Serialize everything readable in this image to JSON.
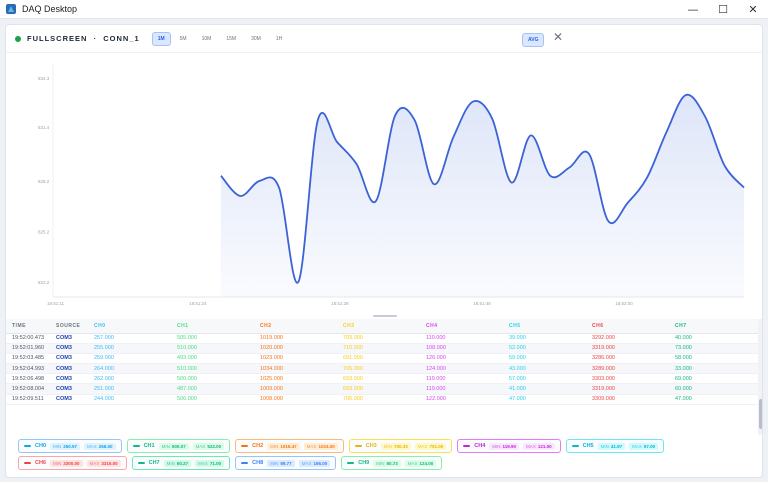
{
  "window": {
    "title": "DAQ Desktop",
    "controls": [
      "—",
      "☐",
      "✕"
    ]
  },
  "toolbar": {
    "mode_label": "FULLSCREEN",
    "separator": "·",
    "connection": "CONN_1",
    "ranges": [
      "1M",
      "5M",
      "10M",
      "15M",
      "30M",
      "1H"
    ],
    "active_range": "1M",
    "avg_label": "AVG",
    "close_glyph": "✕",
    "status_color": "#16a34a"
  },
  "chart_data": {
    "type": "area",
    "title": "",
    "xlabel": "",
    "ylabel": "",
    "line_color": "#3b63d6",
    "fill_color": "#dce4f8",
    "y_ticks": [
      822.2,
      825.2,
      828.2,
      831.4,
      834.3
    ],
    "y_tick_labels": [
      "822.2",
      "825.2",
      "828.2",
      "831.4",
      "834.3"
    ],
    "ylim": [
      821.3,
      835.2
    ],
    "x_ticks": [
      0,
      11,
      22,
      33,
      44
    ],
    "x_tick_labels": [
      "18:51:11",
      "18:51:24",
      "18:51:38",
      "18:51:48",
      "18:52:00"
    ],
    "xlim": [
      0,
      53.5
    ],
    "x": [
      13,
      14.5,
      16,
      17.5,
      19,
      20.5,
      22,
      23.5,
      25,
      26.5,
      28,
      29.5,
      31,
      32.5,
      34,
      35.5,
      37,
      38.5,
      40,
      41.5,
      43,
      44.5,
      46,
      47.5,
      49,
      50.5,
      52,
      53.5
    ],
    "y": [
      828.5,
      827.3,
      828.2,
      827.8,
      822.2,
      831.8,
      830.5,
      829.2,
      827.0,
      832.1,
      831.8,
      828.0,
      830.8,
      832.9,
      831.9,
      828.1,
      830.9,
      828.5,
      829.0,
      829.8,
      825.8,
      826.9,
      828.4,
      831.1,
      833.3,
      832.0,
      829.1,
      827.8
    ]
  },
  "table": {
    "columns": [
      {
        "label": "TIME",
        "color": "#6b7280"
      },
      {
        "label": "SOURCE",
        "color": "#6b7280"
      },
      {
        "label": "CH0",
        "color": "#38bdf8"
      },
      {
        "label": "CH1",
        "color": "#4ade80"
      },
      {
        "label": "CH2",
        "color": "#f97316"
      },
      {
        "label": "CH3",
        "color": "#facc15"
      },
      {
        "label": "CH4",
        "color": "#d946ef"
      },
      {
        "label": "CH5",
        "color": "#22d3ee"
      },
      {
        "label": "CH6",
        "color": "#ef4444"
      },
      {
        "label": "CH7",
        "color": "#10b981"
      }
    ],
    "rows": [
      [
        "19:52:00.473",
        "COM3",
        "257.000",
        "505.000",
        "1019.000",
        "703.000",
        "110.000",
        "39.000",
        "3292.000",
        "40.000"
      ],
      [
        "19:52:01.960",
        "COM3",
        "255.000",
        "510.000",
        "1020.000",
        "710.000",
        "108.000",
        "52.000",
        "3319.000",
        "73.000"
      ],
      [
        "19:52:03.485",
        "COM3",
        "259.000",
        "493.000",
        "1023.000",
        "691.000",
        "126.000",
        "59.000",
        "3286.000",
        "58.000"
      ],
      [
        "19:52:04.993",
        "COM3",
        "264.000",
        "510.000",
        "1034.000",
        "705.000",
        "124.000",
        "43.000",
        "3289.000",
        "33.000"
      ],
      [
        "19:52:06.498",
        "COM3",
        "262.000",
        "500.000",
        "1025.000",
        "693.000",
        "119.000",
        "57.000",
        "3303.000",
        "69.000"
      ],
      [
        "19:52:08.004",
        "COM3",
        "251.000",
        "487.000",
        "1009.000",
        "693.000",
        "119.000",
        "41.000",
        "3319.000",
        "60.000"
      ],
      [
        "19:52:09.511",
        "COM3",
        "244.000",
        "506.000",
        "1008.000",
        "706.000",
        "122.000",
        "47.000",
        "3309.000",
        "47.000"
      ]
    ],
    "time_color": "#4b5563",
    "source_color": "#1e40af"
  },
  "channels": [
    {
      "name": "CH0",
      "color": "#0ea5e9",
      "bg": "#e0f2fe",
      "border": "#93c5fd",
      "min_key": "MIN",
      "min": "250.97",
      "max_key": "MAX",
      "max": "266.00"
    },
    {
      "name": "CH1",
      "color": "#10b981",
      "bg": "#dcfce7",
      "border": "#86efac",
      "min_key": "MIN",
      "min": "500.07",
      "max_key": "MAX",
      "max": "522.00"
    },
    {
      "name": "CH2",
      "color": "#f97316",
      "bg": "#ffedd5",
      "border": "#fdba74",
      "min_key": "MIN",
      "min": "1016.47",
      "max_key": "MAX",
      "max": "1024.00"
    },
    {
      "name": "CH3",
      "color": "#eab308",
      "bg": "#fef9c3",
      "border": "#fde047",
      "min_key": "MIN",
      "min": "700.33",
      "max_key": "MAX",
      "max": "701.00"
    },
    {
      "name": "CH4",
      "color": "#c026d3",
      "bg": "#fae8ff",
      "border": "#e879f9",
      "min_key": "MIN",
      "min": "119.90",
      "max_key": "MAX",
      "max": "121.00"
    },
    {
      "name": "CH5",
      "color": "#06b6d4",
      "bg": "#cffafe",
      "border": "#67e8f9",
      "min_key": "MIN",
      "min": "41.97",
      "max_key": "MAX",
      "max": "57.00"
    },
    {
      "name": "CH6",
      "color": "#ef4444",
      "bg": "#fee2e2",
      "border": "#fca5a5",
      "min_key": "MIN",
      "min": "3300.00",
      "max_key": "MAX",
      "max": "3315.00"
    },
    {
      "name": "CH7",
      "color": "#10b981",
      "bg": "#d1fae5",
      "border": "#6ee7b7",
      "min_key": "MIN",
      "min": "60.27",
      "max_key": "MAX",
      "max": "71.00"
    },
    {
      "name": "CH8",
      "color": "#3b82f6",
      "bg": "#dbeafe",
      "border": "#93c5fd",
      "min_key": "MIN",
      "min": "89.77",
      "max_key": "MAX",
      "max": "166.00"
    },
    {
      "name": "CH9",
      "color": "#10b981",
      "bg": "#dcfce7",
      "border": "#86efac",
      "min_key": "MIN",
      "min": "80.73",
      "max_key": "MAX",
      "max": "124.00"
    }
  ]
}
